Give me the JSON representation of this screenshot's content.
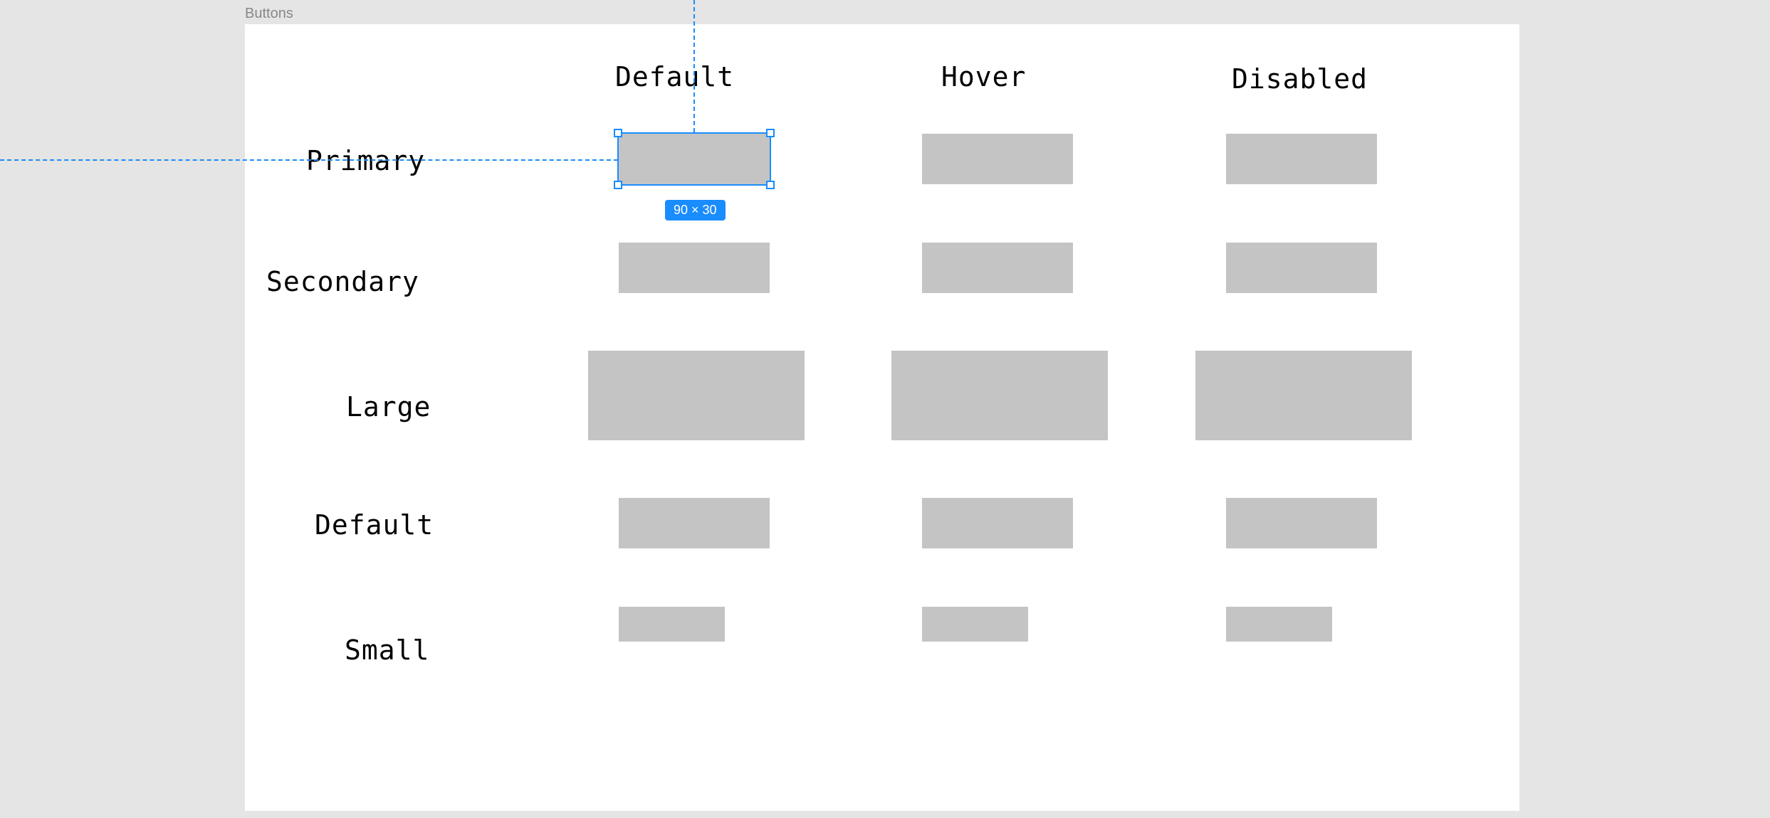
{
  "frame_label": "Buttons",
  "columns": [
    "Default",
    "Hover",
    "Disabled"
  ],
  "rows": [
    "Primary",
    "Secondary",
    "Large",
    "Default",
    "Small"
  ],
  "selection": {
    "size_label": "90 × 30"
  },
  "colors": {
    "canvas_bg": "#e5e5e5",
    "frame_bg": "#ffffff",
    "swatch": "#c4c4c4",
    "selection": "#198cfe",
    "label_muted": "#888888"
  }
}
